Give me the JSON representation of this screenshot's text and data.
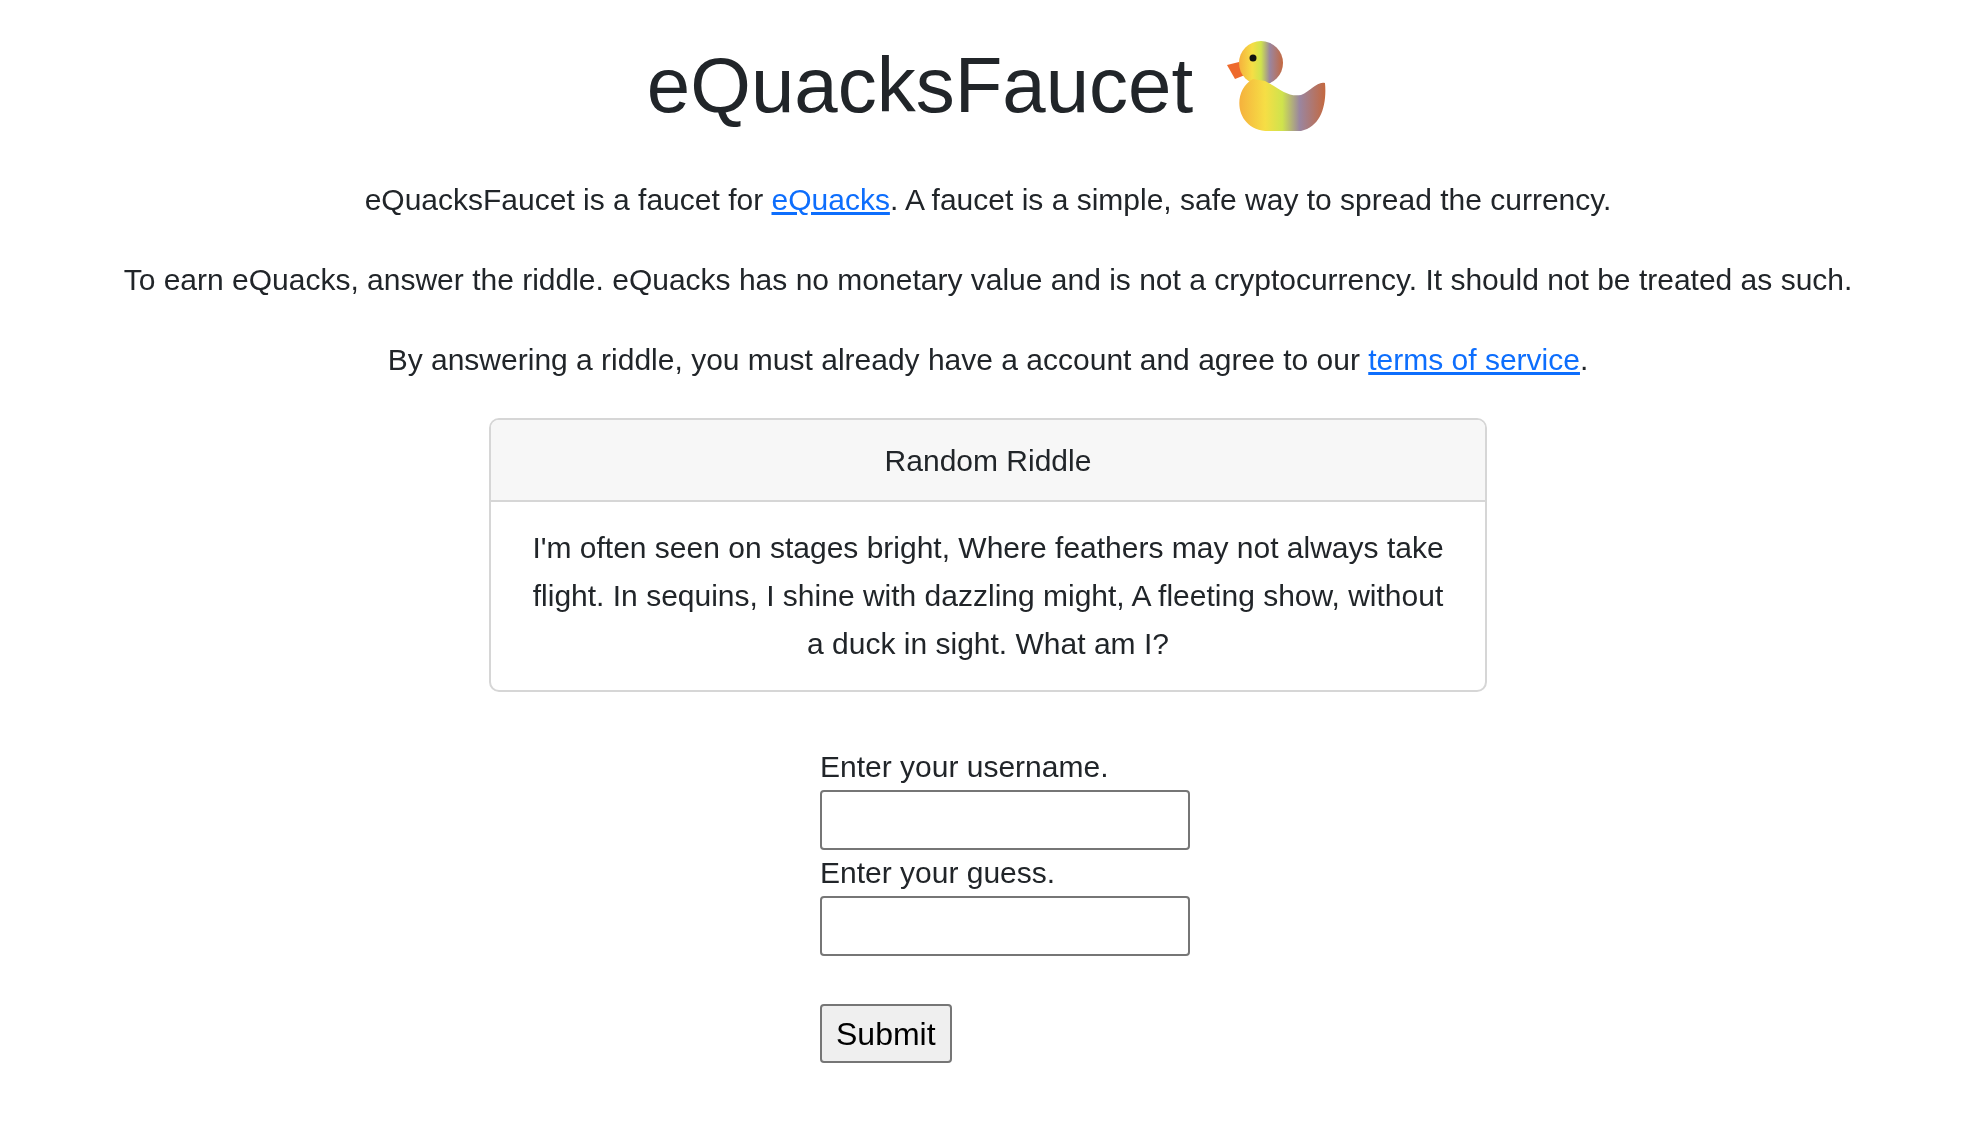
{
  "title": "eQuacksFaucet",
  "paragraphs": [
    {
      "parts": [
        {
          "kind": "text",
          "text": "eQuacksFaucet is a faucet for "
        },
        {
          "kind": "link",
          "text": "eQuacks"
        },
        {
          "kind": "text",
          "text": ". A faucet is a simple, safe way to spread the currency."
        }
      ]
    },
    {
      "parts": [
        {
          "kind": "text",
          "text": "To earn eQuacks, answer the riddle. eQuacks has no monetary value and is not a cryptocurrency. It should not be treated as such."
        }
      ]
    },
    {
      "parts": [
        {
          "kind": "text",
          "text": "By answering a riddle, you must already have a account and agree to our "
        },
        {
          "kind": "link",
          "text": "terms of service"
        },
        {
          "kind": "text",
          "text": "."
        }
      ]
    }
  ],
  "card": {
    "header": "Random Riddle",
    "body": "I'm often seen on stages bright, Where feathers may not always take flight. In sequins, I shine with dazzling might, A fleeting show, without a duck in sight. What am I?"
  },
  "form": {
    "fields": [
      {
        "label": "Enter your username."
      },
      {
        "label": "Enter your guess."
      }
    ],
    "submit": "Submit"
  }
}
